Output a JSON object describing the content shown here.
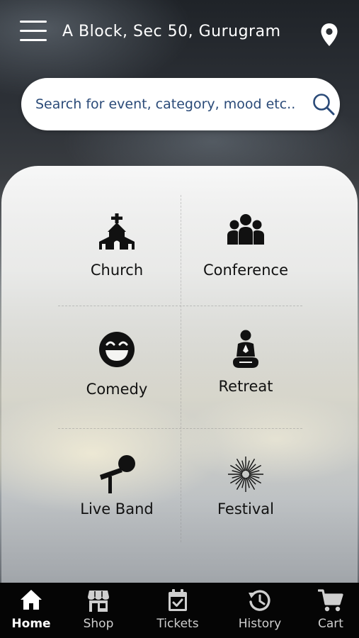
{
  "header": {
    "location": "A Block, Sec 50, Gurugram",
    "menu_icon": "hamburger-menu-icon",
    "pin_icon": "map-pin-icon"
  },
  "search": {
    "placeholder": "Search for event, category, mood etc..",
    "icon": "search-icon"
  },
  "categories": [
    {
      "label": "Church",
      "icon": "church-icon"
    },
    {
      "label": "Conference",
      "icon": "group-people-icon"
    },
    {
      "label": "Comedy",
      "icon": "laughing-face-icon"
    },
    {
      "label": "Retreat",
      "icon": "meditation-icon"
    },
    {
      "label": "Live Band",
      "icon": "microphone-icon"
    },
    {
      "label": "Festival",
      "icon": "firework-icon"
    }
  ],
  "bottom_nav": {
    "items": [
      {
        "label": "Home",
        "icon": "home-icon",
        "active": true
      },
      {
        "label": "Shop",
        "icon": "storefront-icon",
        "active": false
      },
      {
        "label": "Tickets",
        "icon": "calendar-check-icon",
        "active": false
      },
      {
        "label": "History",
        "icon": "history-icon",
        "active": false
      },
      {
        "label": "Cart",
        "icon": "cart-icon",
        "active": false
      }
    ]
  },
  "colors": {
    "search_text": "#2a4a78",
    "nav_background": "#050505",
    "icon_color": "#111111"
  }
}
